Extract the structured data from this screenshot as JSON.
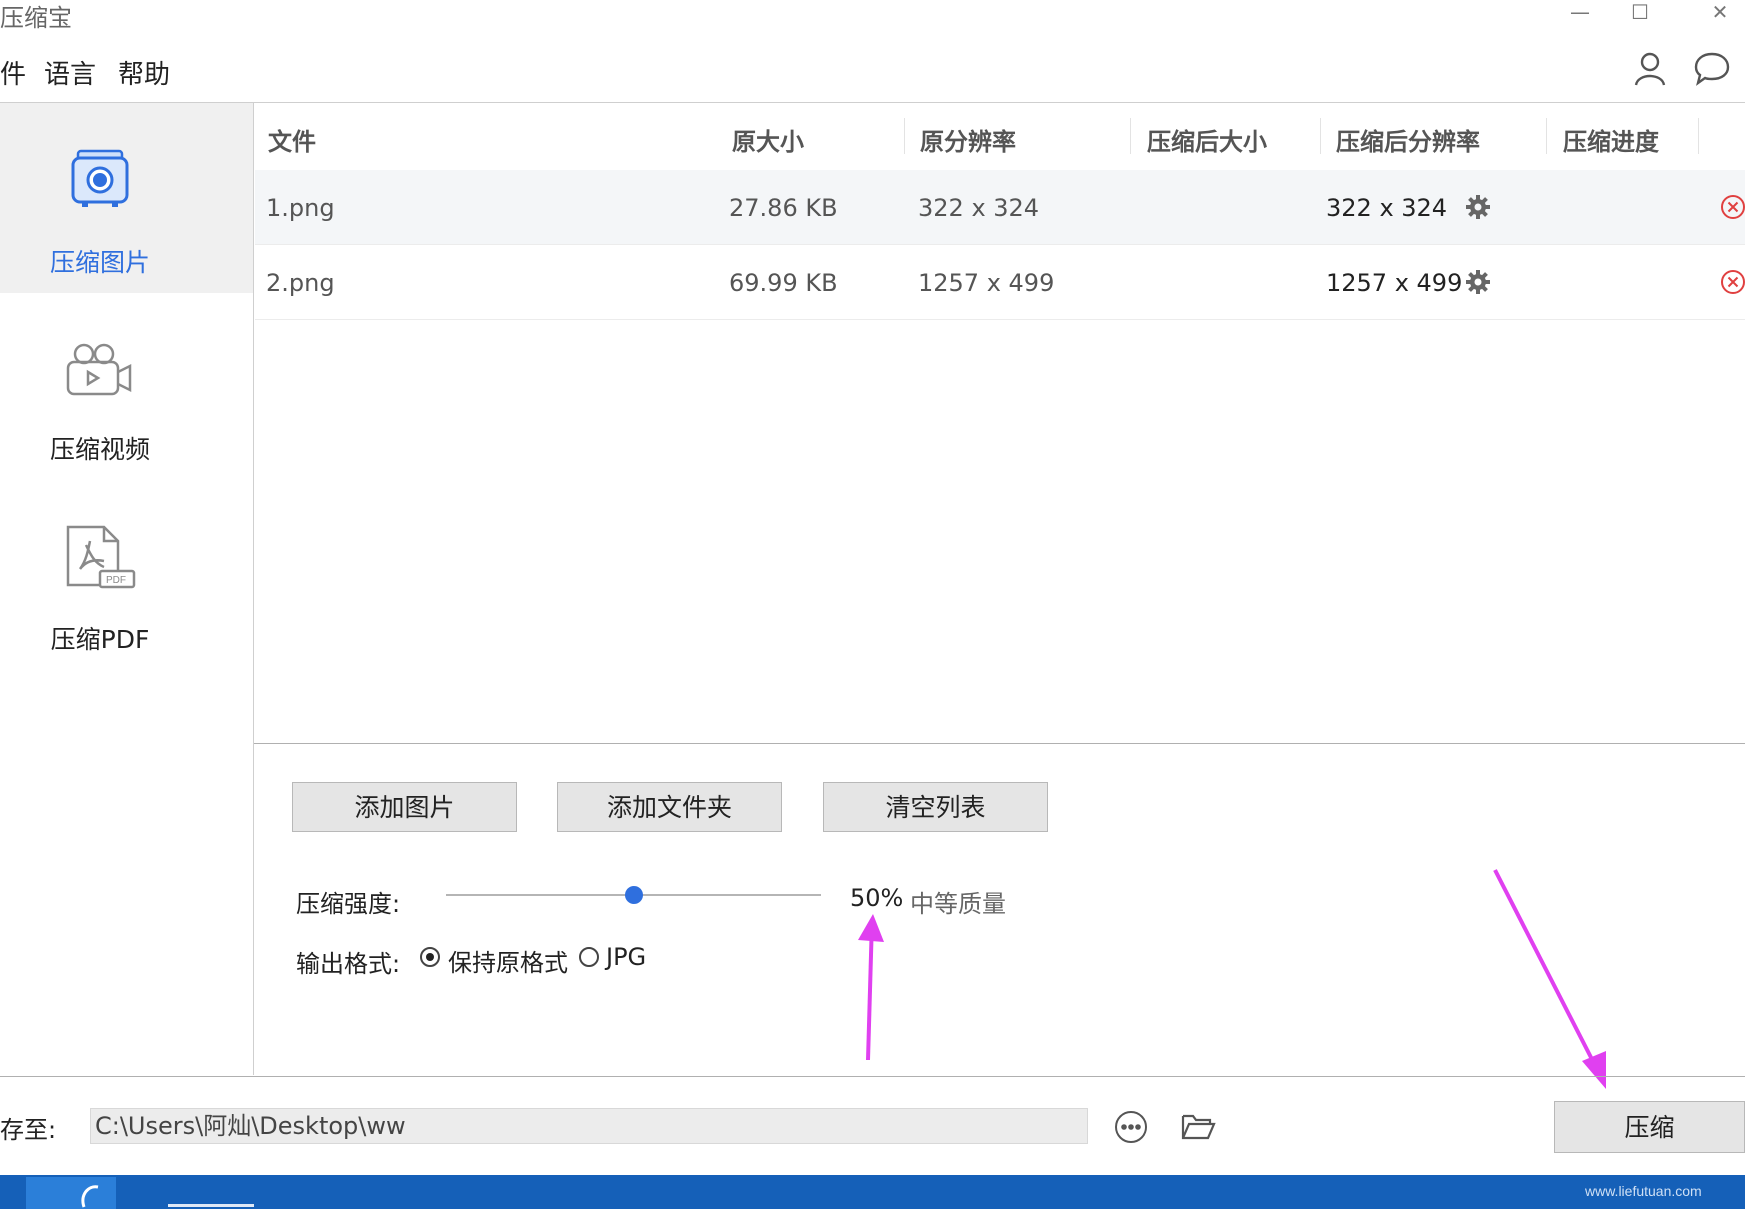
{
  "window": {
    "title": "压缩宝",
    "minimize": "—",
    "maximize": "☐",
    "close": "✕"
  },
  "menu": {
    "items": [
      "件",
      "语言",
      "帮助"
    ]
  },
  "sidebar": {
    "items": [
      {
        "label": "压缩图片",
        "active": true
      },
      {
        "label": "压缩视频",
        "active": false
      },
      {
        "label": "压缩PDF",
        "active": false
      }
    ]
  },
  "table": {
    "headers": [
      "文件",
      "原大小",
      "原分辨率",
      "压缩后大小",
      "压缩后分辨率",
      "压缩进度"
    ],
    "rows": [
      {
        "file": "1.png",
        "size": "27.86 KB",
        "resolution": "322 x 324",
        "compressed_size": "",
        "compressed_resolution": "322 x 324",
        "progress": ""
      },
      {
        "file": "2.png",
        "size": "69.99 KB",
        "resolution": "1257 x 499",
        "compressed_size": "",
        "compressed_resolution": "1257 x 499",
        "progress": ""
      }
    ]
  },
  "actions": {
    "add_image": "添加图片",
    "add_folder": "添加文件夹",
    "clear_list": "清空列表"
  },
  "settings": {
    "strength_label": "压缩强度:",
    "strength_value": 50,
    "strength_percent": "50%",
    "strength_quality": "中等质量",
    "format_label": "输出格式:",
    "format_options": [
      "保持原格式",
      "JPG"
    ],
    "format_selected": "保持原格式"
  },
  "footer": {
    "save_label": "存至:",
    "path": "C:\\Users\\阿灿\\Desktop\\ww",
    "compress_button": "压缩",
    "watermark": "www.liefutuan.com"
  },
  "colors": {
    "accent": "#2f6fde",
    "arrow": "#e040f0",
    "taskbar": "#1560b8"
  }
}
